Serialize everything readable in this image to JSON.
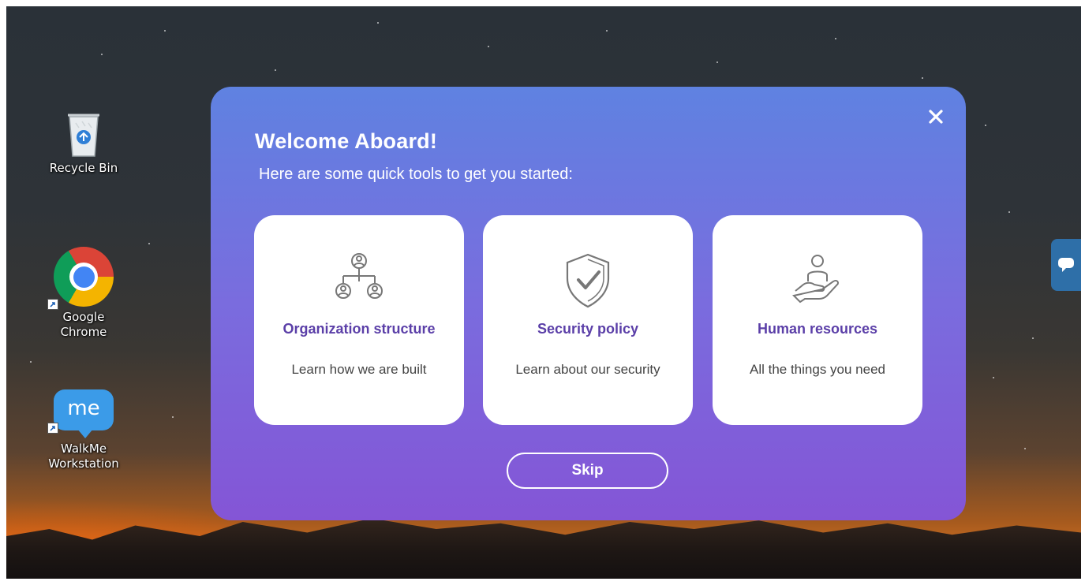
{
  "desktop": {
    "icons": [
      {
        "label": "Recycle Bin",
        "icon": "recycle-bin-icon"
      },
      {
        "label": "Google Chrome",
        "icon": "chrome-icon"
      },
      {
        "label": "WalkMe Workstation",
        "icon": "walkme-icon",
        "glyph_text": "me"
      }
    ]
  },
  "modal": {
    "title": "Welcome Aboard!",
    "subtitle": "Here are some quick tools to get you started:",
    "close_icon": "close-icon",
    "cards": [
      {
        "title": "Organization structure",
        "description": "Learn how we are built",
        "icon": "org-chart-icon"
      },
      {
        "title": "Security policy",
        "description": "Learn about our security",
        "icon": "shield-check-icon"
      },
      {
        "title": "Human resources",
        "description": "All the things you need",
        "icon": "hand-person-icon"
      }
    ],
    "skip_label": "Skip"
  },
  "side_tab": {
    "icon": "chat-bubble-icon"
  },
  "colors": {
    "modal_gradient_top": "#5f82e1",
    "modal_gradient_bottom": "#8455d6",
    "card_title": "#5b3fa8",
    "walkme_blue": "#3b9be8"
  }
}
